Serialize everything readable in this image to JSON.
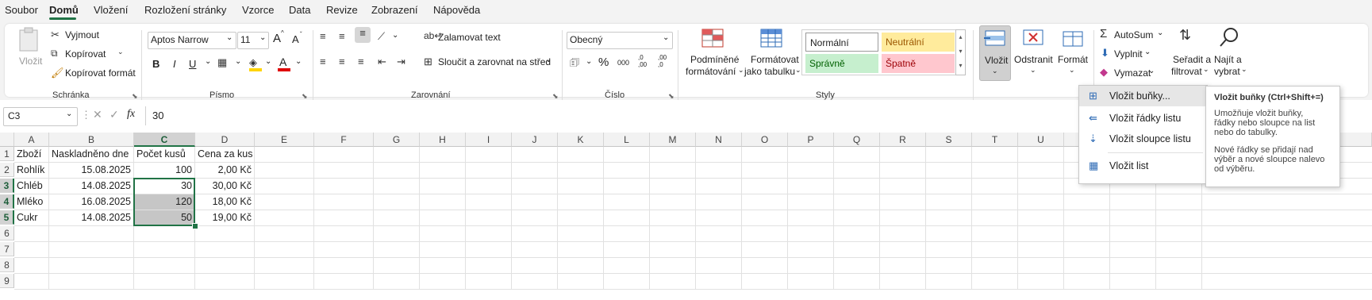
{
  "menu": {
    "items": [
      "Soubor",
      "Domů",
      "Vložení",
      "Rozložení stránky",
      "Vzorce",
      "Data",
      "Revize",
      "Zobrazení",
      "Nápověda"
    ],
    "active": "Domů"
  },
  "ribbon": {
    "clipboard": {
      "paste": "Vložit",
      "cut": "Vyjmout",
      "copy": "Kopírovat",
      "format_painter": "Kopírovat formát",
      "label": "Schránka"
    },
    "font": {
      "name": "Aptos Narrow",
      "size": "11",
      "bold": "B",
      "italic": "I",
      "underline": "U",
      "grow": "A",
      "shrink": "A",
      "color_letter": "A",
      "label": "Písmo"
    },
    "alignment": {
      "wrap": "Zalamovat text",
      "merge": "Sloučit a zarovnat na střed",
      "label": "Zarovnání"
    },
    "number": {
      "format": "Obecný",
      "percent": "%",
      "thousands": "000",
      "inc_dec": ",0\n,00",
      "dec_dec": ",00\n,0",
      "label": "Číslo"
    },
    "styles": {
      "conditional": "Podmíněné",
      "conditional2": "formátování",
      "table": "Formátovat",
      "table2": "jako tabulku",
      "normal": "Normální",
      "neutral": "Neutrální",
      "good": "Správně",
      "bad": "Špatně",
      "label": "Styly"
    },
    "cells": {
      "insert": "Vložit",
      "delete": "Odstranit",
      "format": "Formát"
    },
    "editing": {
      "autosum": "AutoSum",
      "fill": "Vyplnit",
      "clear": "Vymazat",
      "sort": "Seřadit a",
      "sort2": "filtrovat",
      "find": "Najít a",
      "find2": "vybrat"
    }
  },
  "formula_bar": {
    "name_box": "C3",
    "fx": "fx",
    "value": "30"
  },
  "columns": [
    "A",
    "B",
    "C",
    "D",
    "E",
    "F",
    "G",
    "H",
    "I",
    "J",
    "K",
    "L",
    "M",
    "N",
    "O",
    "P",
    "Q",
    "R",
    "S",
    "T",
    "U",
    "V",
    "W",
    "X",
    "Y"
  ],
  "rows": [
    "1",
    "2",
    "3",
    "4",
    "5",
    "6",
    "7",
    "8",
    "9"
  ],
  "table": {
    "header": [
      "Zboží",
      "Naskladněno dne",
      "Počet kusů",
      "Cena za kus"
    ],
    "data": [
      [
        "Rohlík",
        "15.08.2025",
        "100",
        "2,00 Kč"
      ],
      [
        "Chléb",
        "14.08.2025",
        "30",
        "30,00 Kč"
      ],
      [
        "Mléko",
        "16.08.2025",
        "120",
        "18,00 Kč"
      ],
      [
        "Cukr",
        "14.08.2025",
        "50",
        "19,00 Kč"
      ]
    ]
  },
  "insert_menu": {
    "items": [
      "Vložit buňky...",
      "Vložit řádky listu",
      "Vložit sloupce listu",
      "Vložit list"
    ]
  },
  "tooltip": {
    "title": "Vložit buňky (Ctrl+Shift+=)",
    "line1": "Umožňuje vložit buňky,",
    "line2": "řádky nebo sloupce na list",
    "line3": "nebo do tabulky.",
    "line4": "Nové řádky se přidají nad",
    "line5": "výběr a nové sloupce nalevo",
    "line6": "od výběru."
  },
  "colors": {
    "accent": "#217346",
    "neutral_bg": "#ffeb9c",
    "good_bg": "#c6efce",
    "bad_bg": "#ffc7ce",
    "good_fg": "#006100",
    "bad_fg": "#9c0006",
    "neutral_fg": "#9c5700"
  }
}
